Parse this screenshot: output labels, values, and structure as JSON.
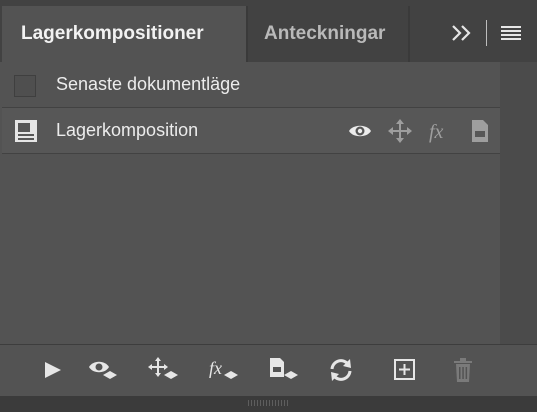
{
  "tabs": [
    {
      "label": "Lagerkompositioner",
      "active": true
    },
    {
      "label": "Anteckningar",
      "active": false
    }
  ],
  "panel_controls": {
    "expand_icon": "double-chevron-right-icon",
    "menu_icon": "hamburger-menu-icon"
  },
  "rows": [
    {
      "label": "Senaste dokumentläge",
      "icon": "empty-checkbox"
    },
    {
      "label": "Lagerkomposition",
      "icon": "layer-comp-icon",
      "row_icons": [
        "visibility-eye-icon",
        "position-move-icon",
        "fx-style-icon",
        "document-appearance-icon"
      ]
    }
  ],
  "toolbar": {
    "icons": [
      "play-icon",
      "apply-visibility-icon",
      "apply-position-icon",
      "apply-fx-icon",
      "apply-appearance-icon",
      "refresh-icon",
      "new-comp-icon",
      "trash-icon"
    ]
  },
  "colors": {
    "panel": "#535353",
    "tabbar": "#424242",
    "text": "#ececec"
  }
}
